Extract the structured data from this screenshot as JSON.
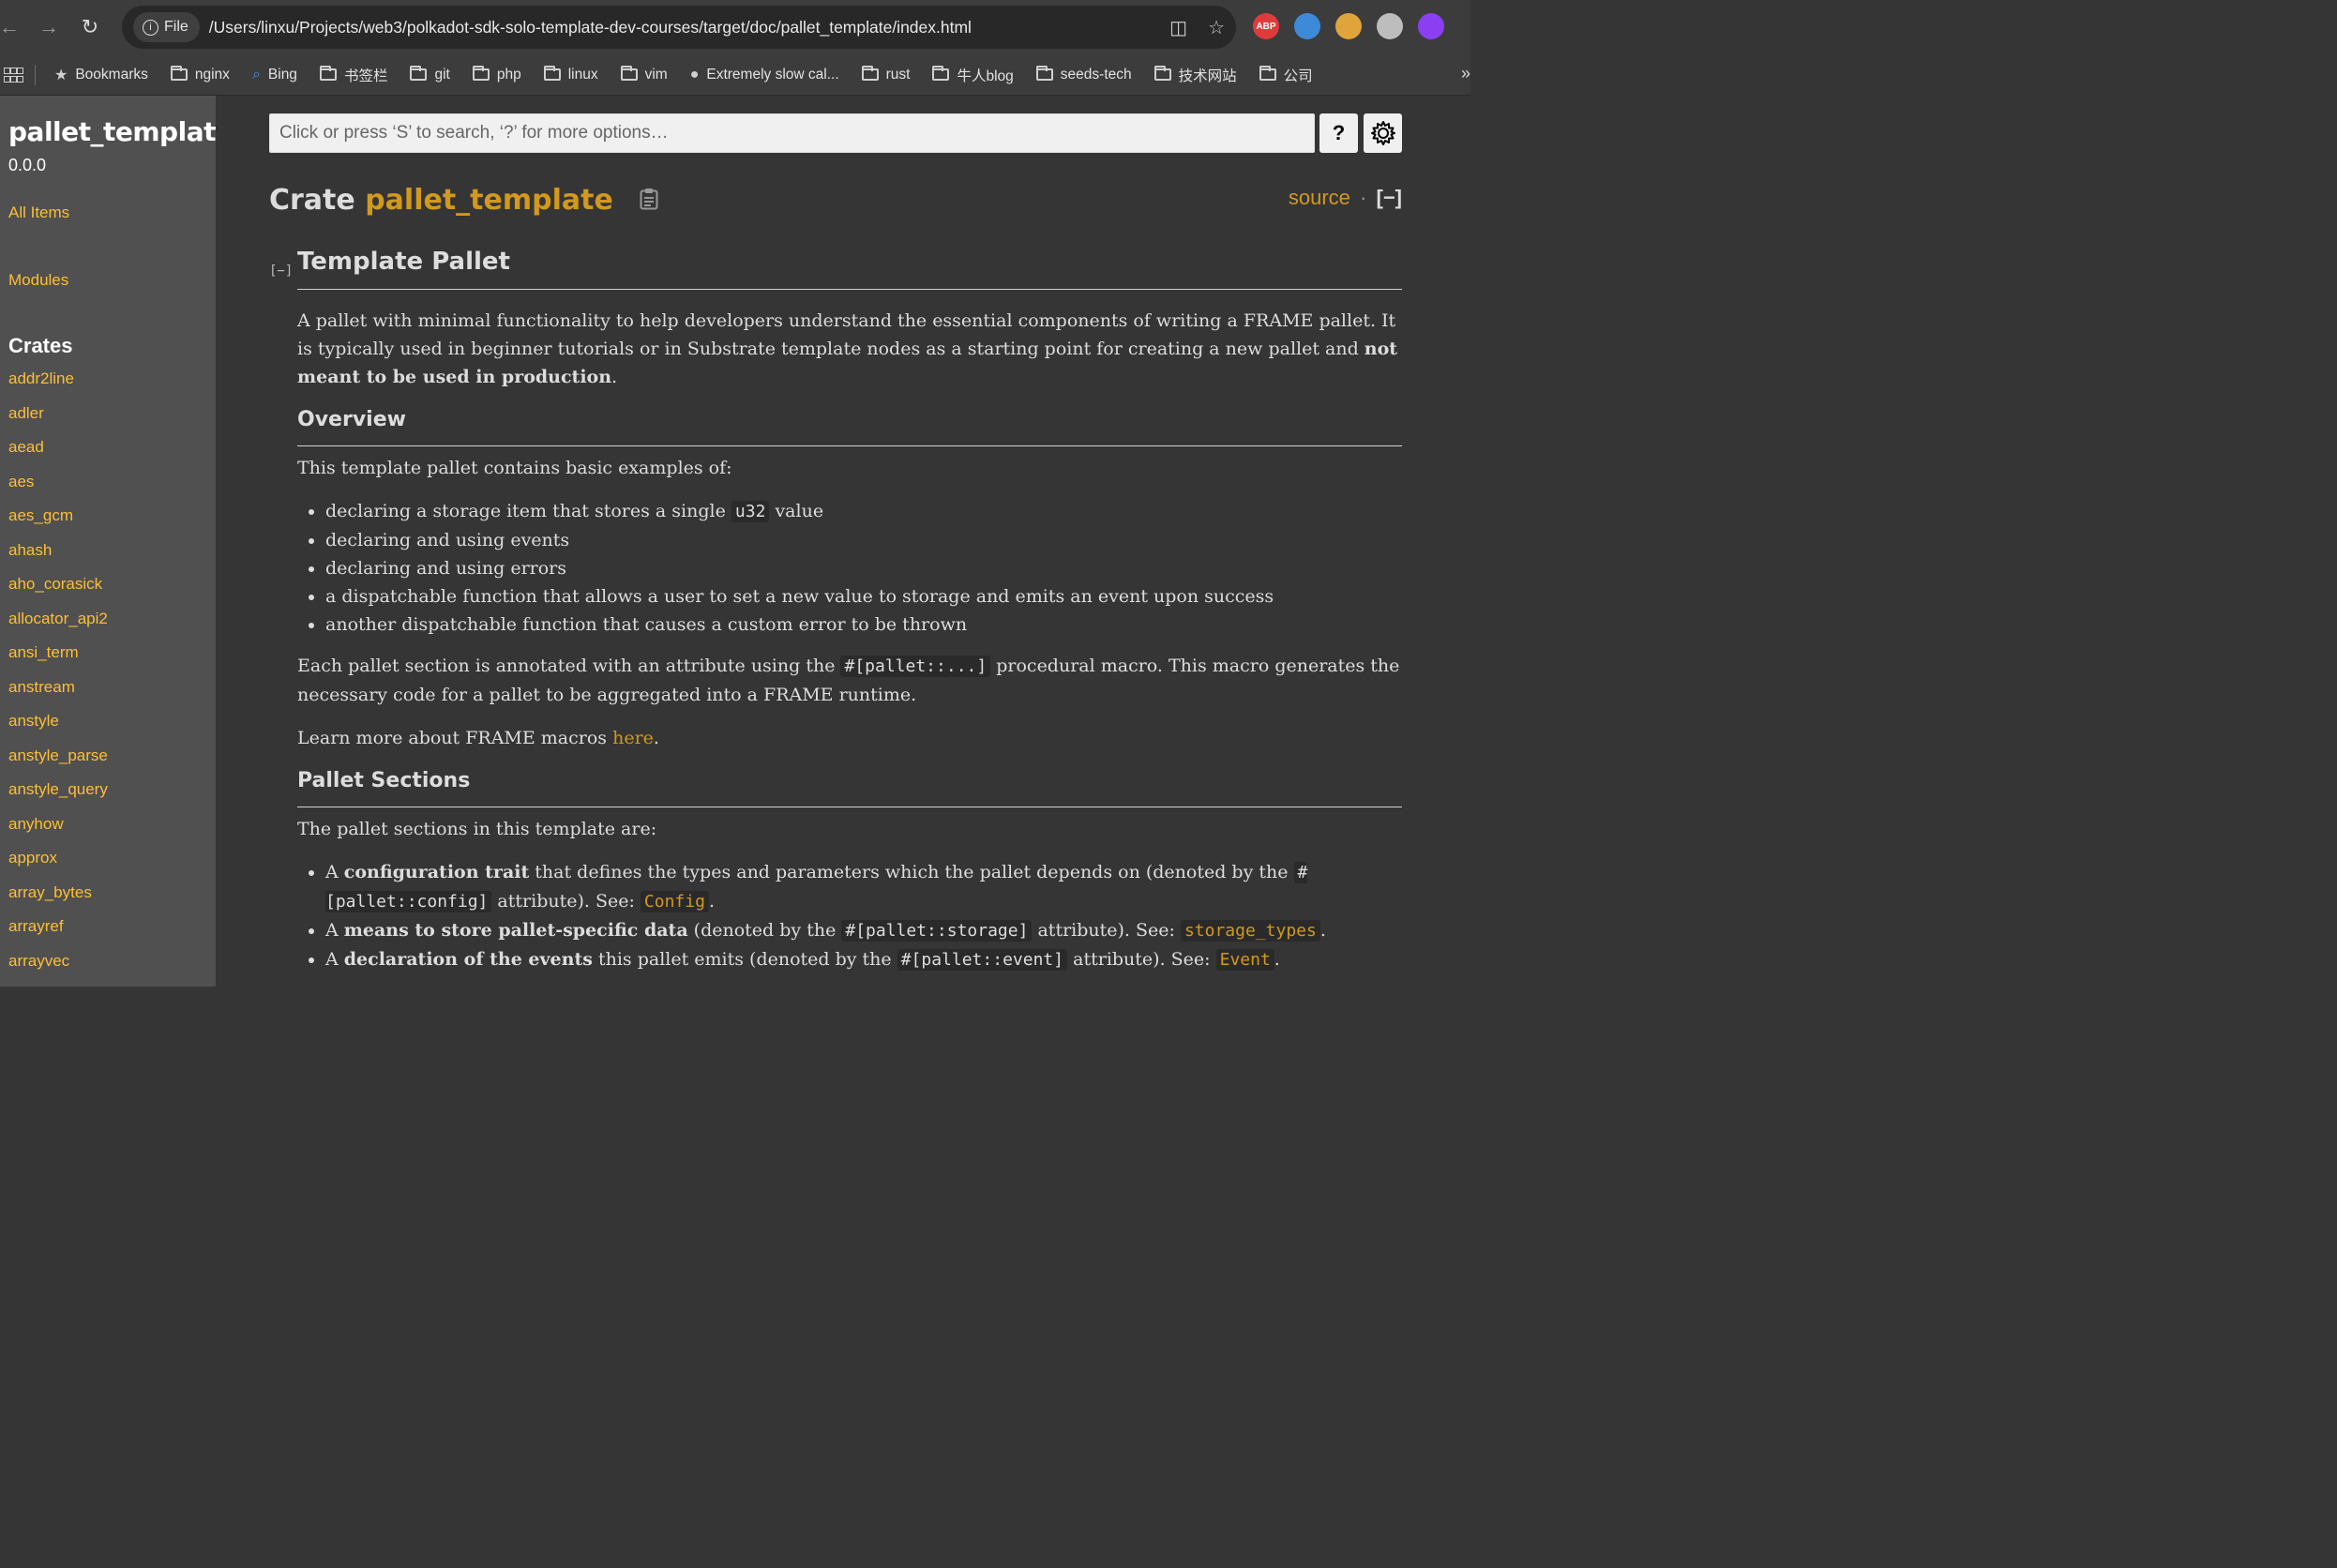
{
  "browser": {
    "file_chip": "File",
    "url": "/Users/linxu/Projects/web3/polkadot-sdk-solo-template-dev-courses/target/doc/pallet_template/index.html",
    "extensions": [
      {
        "name": "abp-icon",
        "label": "ABP",
        "color": "#e03b3b"
      },
      {
        "name": "pen-extension-icon",
        "label": "",
        "color": "#3c8ad8"
      },
      {
        "name": "badge-extension-icon",
        "label": "",
        "color": "#e0a53a"
      },
      {
        "name": "ghost-extension-icon",
        "label": "",
        "color": "#bdbdbd"
      },
      {
        "name": "purple-extension-icon",
        "label": "",
        "color": "#8a3ff2"
      }
    ]
  },
  "bookmarks": [
    {
      "label": "Bookmarks",
      "icon": "star"
    },
    {
      "label": "nginx",
      "icon": "folder"
    },
    {
      "label": "Bing",
      "icon": "search"
    },
    {
      "label": "书签栏",
      "icon": "folder"
    },
    {
      "label": "git",
      "icon": "folder"
    },
    {
      "label": "php",
      "icon": "folder"
    },
    {
      "label": "linux",
      "icon": "folder"
    },
    {
      "label": "vim",
      "icon": "folder"
    },
    {
      "label": "Extremely slow cal...",
      "icon": "github"
    },
    {
      "label": "rust",
      "icon": "folder"
    },
    {
      "label": "牛人blog",
      "icon": "folder"
    },
    {
      "label": "seeds-tech",
      "icon": "folder"
    },
    {
      "label": "技术网站",
      "icon": "folder"
    },
    {
      "label": "公司",
      "icon": "folder"
    }
  ],
  "sidebar": {
    "crate_name": "pallet_template",
    "version": "0.0.0",
    "all_items": "All Items",
    "modules": "Modules",
    "crates_heading": "Crates",
    "crates": [
      "addr2line",
      "adler",
      "aead",
      "aes",
      "aes_gcm",
      "ahash",
      "aho_corasick",
      "allocator_api2",
      "ansi_term",
      "anstream",
      "anstyle",
      "anstyle_parse",
      "anstyle_query",
      "anyhow",
      "approx",
      "array_bytes",
      "arrayref",
      "arrayvec"
    ]
  },
  "search": {
    "placeholder": "Click or press ‘S’ to search, ‘?’ for more options…",
    "help_label": "?"
  },
  "header": {
    "prefix": "Crate",
    "crate": "pallet_template",
    "source": "source",
    "sep": "·",
    "toggle": "[−]"
  },
  "doc": {
    "collapse": "[−]",
    "title": "Template Pallet",
    "intro_1": "A pallet with minimal functionality to help developers understand the essential components of writing a FRAME pallet. It is typically used in beginner tutorials or in Substrate template nodes as a starting point for creating a new pallet and ",
    "intro_bold": "not meant to be used in production",
    "intro_end": ".",
    "overview_heading": "Overview",
    "overview_text": "This template pallet contains basic examples of:",
    "bullets": {
      "b1_pre": "declaring a storage item that stores a single ",
      "b1_code": "u32",
      "b1_post": " value",
      "b2": "declaring and using events",
      "b3": "declaring and using errors",
      "b4": "a dispatchable function that allows a user to set a new value to storage and emits an event upon success",
      "b5": "another dispatchable function that causes a custom error to be thrown"
    },
    "annot_pre": "Each pallet section is annotated with an attribute using the ",
    "annot_code": "#[pallet::...]",
    "annot_post": " procedural macro. This macro generates the necessary code for a pallet to be aggregated into a FRAME runtime.",
    "learn_pre": "Learn more about FRAME macros ",
    "learn_link": "here",
    "learn_post": ".",
    "sections_heading": "Pallet Sections",
    "sections_text": "The pallet sections in this template are:",
    "sec1": {
      "pre": "A ",
      "bold": "configuration trait",
      "mid": " that defines the types and parameters which the pallet depends on (denoted by the ",
      "code": "#[pallet::config]",
      "post": " attribute). See: ",
      "link": "Config",
      "end": "."
    },
    "sec2": {
      "pre": "A ",
      "bold": "means to store pallet-specific data",
      "mid": " (denoted by the ",
      "code": "#[pallet::storage]",
      "post": " attribute). See: ",
      "link": "storage_types",
      "end": "."
    },
    "sec3": {
      "pre": "A ",
      "bold": "declaration of the events",
      "mid": " this pallet emits (denoted by the ",
      "code": "#[pallet::event]",
      "post": " attribute). See: ",
      "link": "Event",
      "end": "."
    }
  }
}
